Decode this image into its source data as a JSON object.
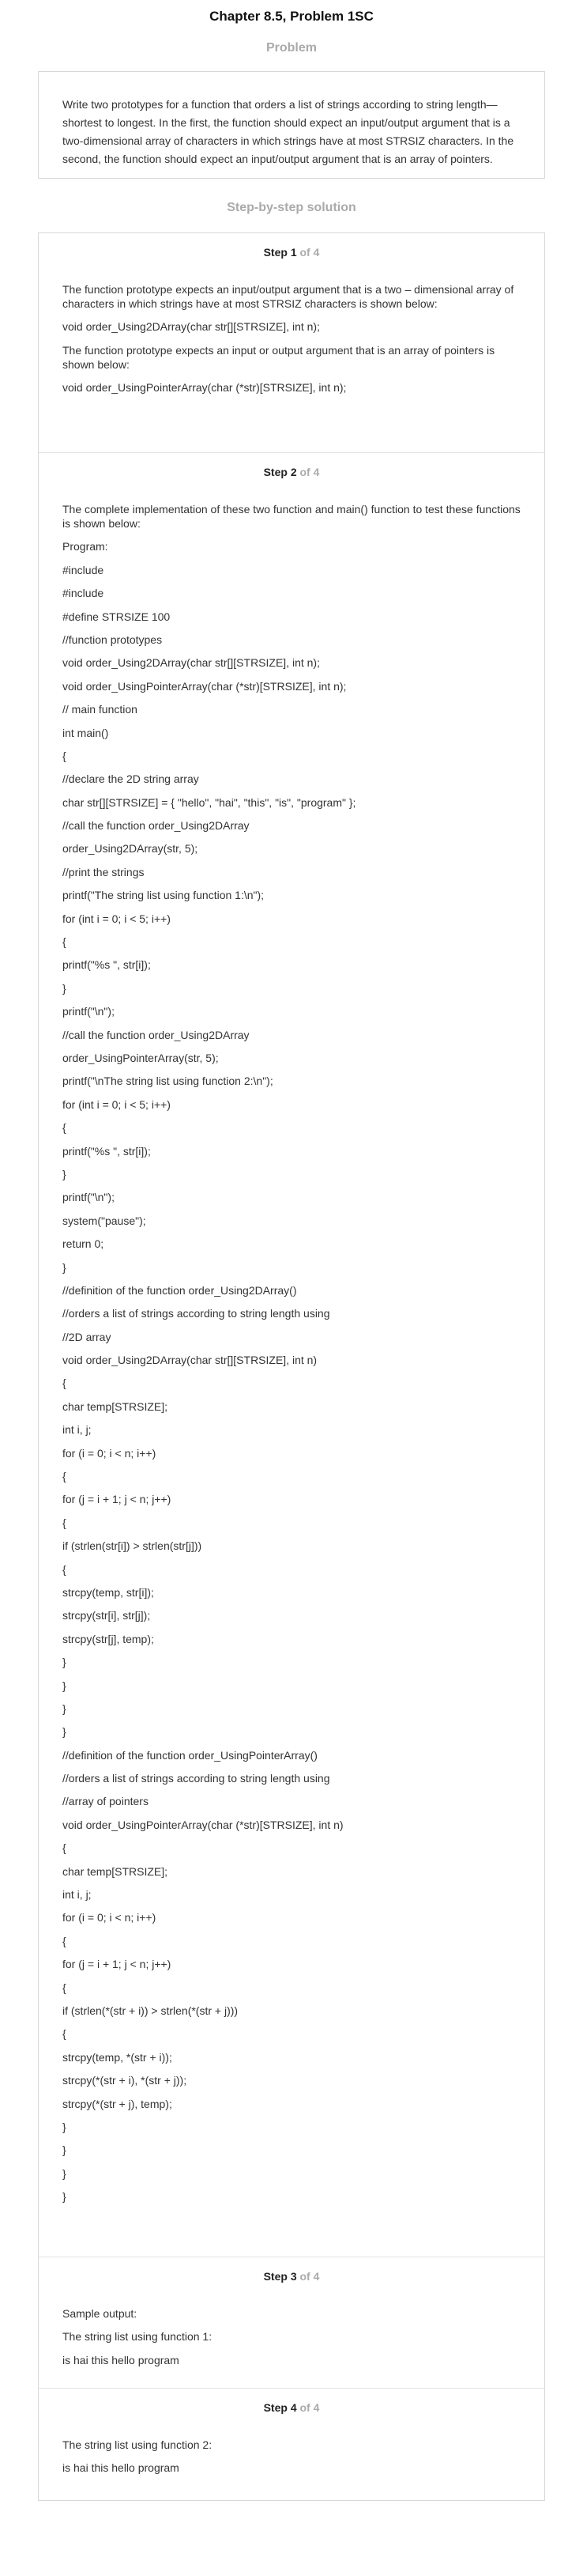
{
  "header": {
    "chapter_title": "Chapter 8.5, Problem 1SC",
    "problem_heading": "Problem",
    "problem_text": "Write two prototypes for a function that orders a list of strings according to string length—shortest to longest. In the first, the function should expect an input/output argument that is a two-dimensional array of characters in which strings have at most STRSIZ characters. In the second, the function should expect an input/output argument that is an array of pointers.",
    "solution_heading": "Step-by-step solution"
  },
  "steps": [
    {
      "label": "Step 1",
      "of": "of 4",
      "lines": [
        "The function prototype expects an input/output argument that is a two – dimensional array of characters in which strings have at most STRSIZ characters is shown below:",
        "void order_Using2DArray(char str[][STRSIZE], int n);",
        "The function prototype expects an input or output argument that is an array of pointers is shown below:",
        "void order_UsingPointerArray(char (*str)[STRSIZE], int n);"
      ]
    },
    {
      "label": "Step 2",
      "of": "of 4",
      "lines": [
        "The complete implementation of these two function and main() function to test these functions is shown below:",
        "Program:",
        "#include",
        "#include",
        "#define STRSIZE 100",
        "//function prototypes",
        "void order_Using2DArray(char str[][STRSIZE], int n);",
        "void order_UsingPointerArray(char (*str)[STRSIZE], int n);",
        "// main function",
        "int main()",
        "{",
        "//declare the 2D string array",
        "char str[][STRSIZE] = { \"hello\", \"hai\", \"this\", \"is\", \"program\" };",
        "//call the function order_Using2DArray",
        "order_Using2DArray(str, 5);",
        "//print the strings",
        "printf(\"The string list using function 1:\\n\");",
        "for (int i = 0; i < 5; i++)",
        "{",
        "printf(\"%s \", str[i]);",
        "}",
        "printf(\"\\n\");",
        "//call the function order_Using2DArray",
        "order_UsingPointerArray(str, 5);",
        "printf(\"\\nThe string list using function 2:\\n\");",
        "for (int i = 0; i < 5; i++)",
        "{",
        "printf(\"%s \", str[i]);",
        "}",
        "printf(\"\\n\");",
        "system(\"pause\");",
        "return 0;",
        "}",
        "//definition of the function order_Using2DArray()",
        "//orders a list of strings according to string length using",
        "//2D array",
        "void order_Using2DArray(char str[][STRSIZE], int n)",
        "{",
        "char temp[STRSIZE];",
        "int i, j;",
        "for (i = 0; i < n; i++)",
        "{",
        "for (j = i + 1; j < n; j++)",
        "{",
        "if (strlen(str[i]) > strlen(str[j]))",
        "{",
        "strcpy(temp, str[i]);",
        "strcpy(str[i], str[j]);",
        "strcpy(str[j], temp);",
        "}",
        "}",
        "}",
        "}",
        "//definition of the function order_UsingPointerArray()",
        "//orders a list of strings according to string length using",
        "//array of pointers",
        "void order_UsingPointerArray(char (*str)[STRSIZE], int n)",
        "{",
        "char temp[STRSIZE];",
        "int i, j;",
        "for (i = 0; i < n; i++)",
        "{",
        "for (j = i + 1; j < n; j++)",
        "{",
        "if (strlen(*(str + i)) > strlen(*(str + j)))",
        "{",
        "strcpy(temp, *(str + i));",
        "strcpy(*(str + i), *(str + j));",
        "strcpy(*(str + j), temp);",
        "}",
        "}",
        "}",
        "}"
      ]
    },
    {
      "label": "Step 3",
      "of": "of 4",
      "lines": [
        "Sample output:",
        "The string list using function 1:",
        "is hai this hello program"
      ]
    },
    {
      "label": "Step 4",
      "of": "of 4",
      "lines": [
        "The string list using function 2:",
        "is hai this hello program"
      ]
    }
  ]
}
